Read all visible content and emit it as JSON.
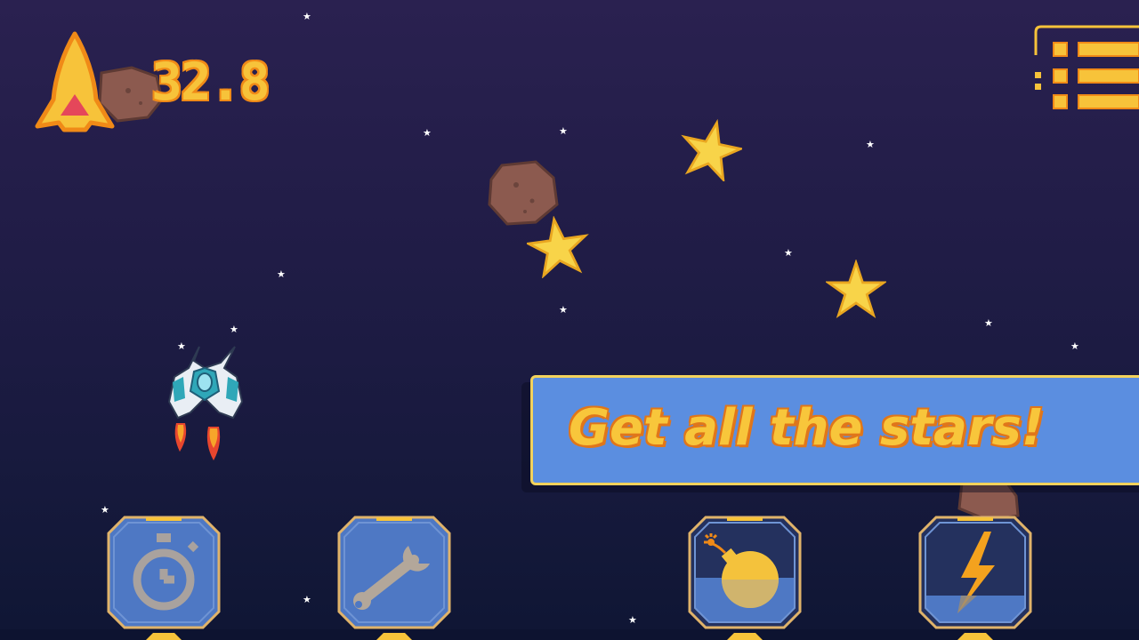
{
  "hud": {
    "score": "32.8",
    "ship_icon": "rocket-icon",
    "menu_icon": "menu-list-icon"
  },
  "banner": {
    "message": "Get all the stars!"
  },
  "powerups": [
    {
      "name": "stopwatch",
      "icon": "stopwatch-icon",
      "charge": 0
    },
    {
      "name": "wrench",
      "icon": "wrench-icon",
      "charge": 0
    },
    {
      "name": "bomb",
      "icon": "bomb-icon",
      "charge": 0.45
    },
    {
      "name": "lightning",
      "icon": "lightning-icon",
      "charge": 0.28
    }
  ],
  "colors": {
    "background_top": "#2a2150",
    "background_bottom": "#0f1634",
    "accent_yellow": "#f7c33a",
    "accent_orange": "#f08a17",
    "banner_blue": "#5b8ee0",
    "powerup_fill": "#4e78c4"
  }
}
